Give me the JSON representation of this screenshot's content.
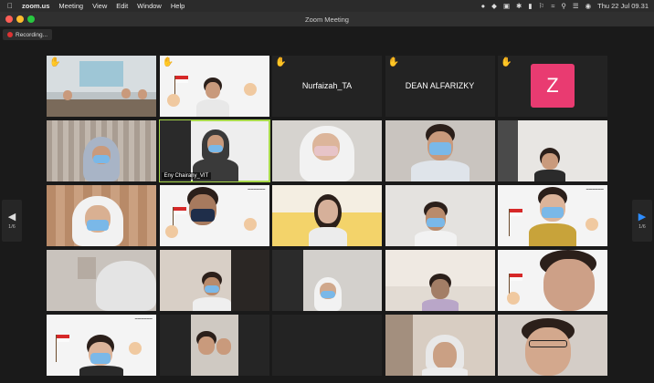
{
  "menubar": {
    "app_name": "zoom.us",
    "items": [
      "Meeting",
      "View",
      "Edit",
      "Window",
      "Help"
    ],
    "clock": "Thu 22 Jul  09.31"
  },
  "window": {
    "title": "Zoom Meeting"
  },
  "recording": {
    "label": "Recording..."
  },
  "pagination": {
    "left_page": "1/6",
    "right_page": "1/6"
  },
  "participants": {
    "nurfaizah": "Nurfaizah_TA",
    "dean": "DEAN ALFARIZKY",
    "z_avatar_letter": "Z",
    "active_speaker_tag": "Eny Chairany_VIT"
  },
  "accent": {
    "zoom_blue": "#2d8cff",
    "active_border": "#a8d94a",
    "avatar_pink": "#e93b71",
    "hand_yellow": "#ffcc3a"
  }
}
